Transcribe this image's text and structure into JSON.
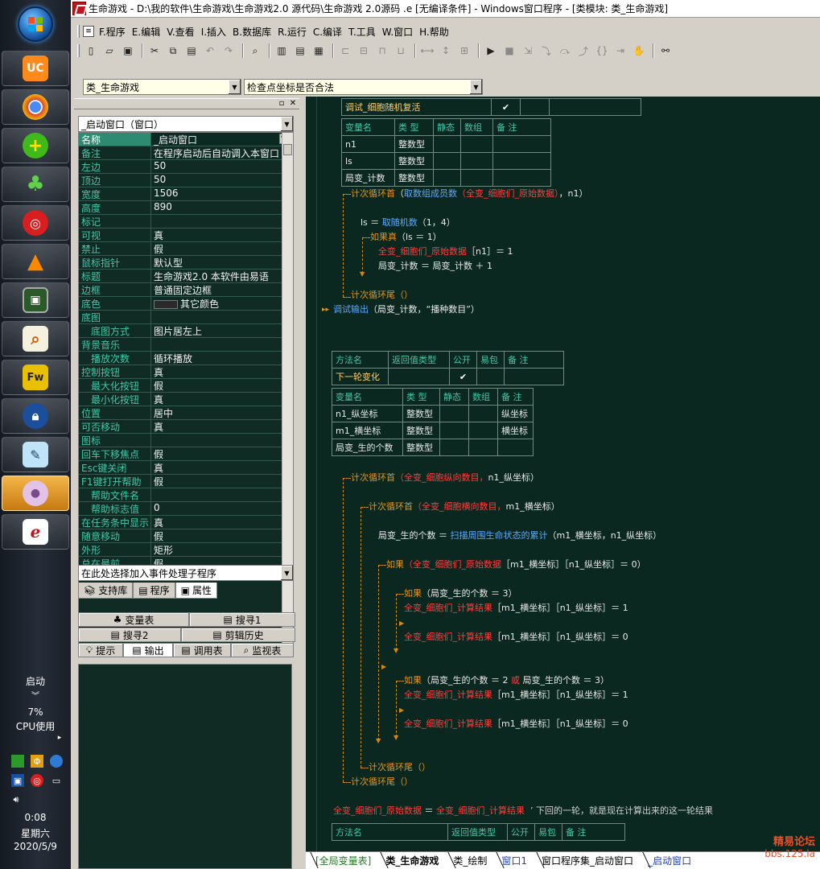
{
  "taskbar": {
    "status_label": "启动",
    "cpu_percent": "7%",
    "cpu_label": "CPU使用",
    "time": "0:08",
    "weekday": "星期六",
    "date": "2020/5/9"
  },
  "window": {
    "title": "生命游戏 - D:\\我的软件\\生命游戏\\生命游戏2.0 源代码\\生命游戏 2.0源码 .e [无编译条件] - Windows窗口程序 - [类模块: 类_生命游戏]"
  },
  "menu": [
    "F.程序",
    "E.编辑",
    "V.查看",
    "I.插入",
    "B.数据库",
    "R.运行",
    "C.编译",
    "T.工具",
    "W.窗口",
    "H.帮助"
  ],
  "selectors": {
    "module": "类_生命游戏",
    "method": "检查点坐标是否合法",
    "object": "_启动窗口（窗口）",
    "event": "在此处选择加入事件处理子程序"
  },
  "properties": [
    {
      "name": "名称",
      "value": "_启动窗口",
      "sel": true
    },
    {
      "name": "备注",
      "value": "在程序启动后自动调入本窗口"
    },
    {
      "name": "左边",
      "value": "50"
    },
    {
      "name": "顶边",
      "value": "50"
    },
    {
      "name": "宽度",
      "value": "1506"
    },
    {
      "name": "高度",
      "value": "890"
    },
    {
      "name": "标记",
      "value": ""
    },
    {
      "name": "可视",
      "value": "真"
    },
    {
      "name": "禁止",
      "value": "假"
    },
    {
      "name": "鼠标指针",
      "value": "默认型"
    },
    {
      "name": "标题",
      "value": "生命游戏2.0      本软件由易语"
    },
    {
      "name": "边框",
      "value": "普通固定边框"
    },
    {
      "name": "底色",
      "value": "其它颜色",
      "swatch": true
    },
    {
      "name": "底图",
      "value": ""
    },
    {
      "name": "底图方式",
      "value": "图片居左上",
      "sub": true
    },
    {
      "name": "背景音乐",
      "value": ""
    },
    {
      "name": "播放次数",
      "value": "循环播放",
      "sub": true
    },
    {
      "name": "控制按钮",
      "value": "真"
    },
    {
      "name": "最大化按钮",
      "value": "假",
      "sub": true
    },
    {
      "name": "最小化按钮",
      "value": "真",
      "sub": true
    },
    {
      "name": "位置",
      "value": "居中"
    },
    {
      "name": "可否移动",
      "value": "真"
    },
    {
      "name": "图标",
      "value": ""
    },
    {
      "name": "回车下移焦点",
      "value": "假"
    },
    {
      "name": "Esc键关闭",
      "value": "真"
    },
    {
      "name": "F1键打开帮助",
      "value": "假"
    },
    {
      "name": "帮助文件名",
      "value": "",
      "sub": true
    },
    {
      "name": "帮助标志值",
      "value": "0",
      "sub": true
    },
    {
      "name": "在任务条中显示",
      "value": "真"
    },
    {
      "name": "随意移动",
      "value": "假"
    },
    {
      "name": "外形",
      "value": "矩形"
    },
    {
      "name": "总在最前",
      "value": "假"
    }
  ],
  "left_tabs": [
    "支持库",
    "程序",
    "属性"
  ],
  "tool_buttons_row1": [
    "变量表",
    "搜寻1"
  ],
  "tool_buttons_row2": [
    "搜寻2",
    "剪辑历史"
  ],
  "tool_tabs": [
    "提示",
    "输出",
    "调用表",
    "监视表"
  ],
  "code": {
    "debug_method": "调试_细胞随机复活",
    "debug_check": "✔",
    "var_headers": [
      "变量名",
      "类 型",
      "静态",
      "数组",
      "备 注"
    ],
    "vars1": [
      {
        "name": "n1",
        "type": "整数型",
        "note": ""
      },
      {
        "name": "ls",
        "type": "整数型",
        "note": ""
      },
      {
        "name": "局变_计数",
        "type": "整数型",
        "note": ""
      }
    ],
    "loop1_head_kw": "计次循环首",
    "loop1_head_open": "（",
    "loop1_head_fn": "取数组成员数",
    "loop1_head_glob": "（全变_细胞们_原始数据）",
    "loop1_head_rest": "，n1）",
    "line_ls": "ls ＝ ",
    "line_ls_fn": "取随机数",
    "line_ls_rest": "（1，4）",
    "if1_kw": "如果真",
    "if1_cond": "（ls ＝ 1）",
    "assign1_glob": "全变_细胞们_原始数据",
    "assign1_rest": "［n1］＝ 1",
    "assign2": "局变_计数 ＝ 局变_计数 ＋ 1",
    "loop1_tail": "计次循环尾（）",
    "debug_out_fn": "调试输出",
    "debug_out_rest": "（局变_计数，“播种数目”）",
    "method_headers": [
      "方法名",
      "返回值类型",
      "公开",
      "易包",
      "备 注"
    ],
    "method2": "下一轮变化",
    "method2_check": "✔",
    "vars2": [
      {
        "name": "n1_纵坐标",
        "type": "整数型",
        "note": "纵坐标"
      },
      {
        "name": "m1_横坐标",
        "type": "整数型",
        "note": "横坐标"
      },
      {
        "name": "局变_生的个数",
        "type": "整数型",
        "note": ""
      }
    ],
    "loopA_kw": "计次循环首",
    "loopA_glob": "（全变_细胞纵向数目，",
    "loopA_rest": "n1_纵坐标）",
    "loopB_kw": "计次循环首",
    "loopB_glob": "（全变_细胞横向数目，",
    "loopB_rest": "m1_横坐标）",
    "count_line": "局变_生的个数 ＝ ",
    "count_fn": "扫描周围生命状态的累计",
    "count_rest": "（m1_横坐标，n1_纵坐标）",
    "ifA_kw": "如果",
    "ifA_glob": "（全变_细胞们_原始数据",
    "ifA_rest": "［m1_横坐标］［n1_纵坐标］＝ 0）",
    "ifB_kw": "如果",
    "ifB_rest": "（局变_生的个数 ＝ 3）",
    "setB1_glob": "全变_细胞们_计算结果",
    "setB1_rest": "［m1_横坐标］［n1_纵坐标］＝ 1",
    "setB2_glob": "全变_细胞们_计算结果",
    "setB2_rest": "［m1_横坐标］［n1_纵坐标］＝ 0",
    "ifC_kw": "如果",
    "ifC_rest": "（局变_生的个数 ＝ 2 ",
    "ifC_or": "或",
    "ifC_rest2": " 局变_生的个数 ＝ 3）",
    "setC1_glob": "全变_细胞们_计算结果",
    "setC1_rest": "［m1_横坐标］［n1_纵坐标］＝ 1",
    "setC2_glob": "全变_细胞们_计算结果",
    "setC2_rest": "［m1_横坐标］［n1_纵坐标］＝ 0",
    "loopB_tail": "计次循环尾（）",
    "loopA_tail": "计次循环尾（）",
    "final_glob1": "全变_细胞们_原始数据",
    "final_eq": " ＝ ",
    "final_glob2": "全变_细胞们_计算结果",
    "final_comment": "  ’ 下回的一轮，就是现在计算出来的这一轮结果",
    "method3_headers": [
      "方法名",
      "返回值类型",
      "公开",
      "易包",
      "备 注"
    ]
  },
  "bottom_tabs": [
    "[全局变量表]",
    "类_生命游戏",
    "类_绘制",
    "窗口1",
    "窗口程序集_启动窗口",
    "_启动窗口"
  ],
  "watermark": {
    "line1": "精易论坛",
    "line2": "bbs.125.la"
  }
}
